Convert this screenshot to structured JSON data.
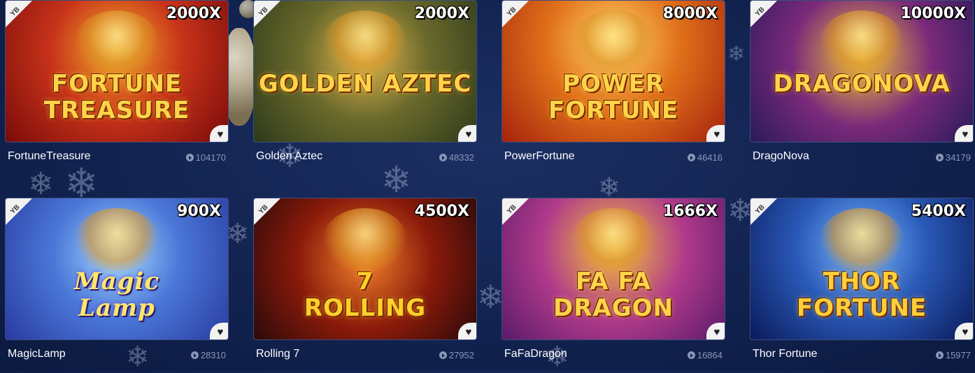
{
  "games": [
    {
      "name": "FortuneTreasure",
      "plays": "104170",
      "multiplier": "2000X",
      "provider": "YB",
      "art_title": "FORTUNE\nTREASURE"
    },
    {
      "name": "Golden Aztec",
      "plays": "48332",
      "multiplier": "2000X",
      "provider": "YB",
      "art_title": "GOLDEN AZTEC"
    },
    {
      "name": "PowerFortune",
      "plays": "46416",
      "multiplier": "8000X",
      "provider": "YB",
      "art_title": "POWER\nFORTUNE"
    },
    {
      "name": "DragoNova",
      "plays": "34179",
      "multiplier": "10000X",
      "provider": "YB",
      "art_title": "DRAGONOVA"
    },
    {
      "name": "MagicLamp",
      "plays": "28310",
      "multiplier": "900X",
      "provider": "YB",
      "art_title": "Magic\nLamp"
    },
    {
      "name": "Rolling 7",
      "plays": "27952",
      "multiplier": "4500X",
      "provider": "YB",
      "art_title": "7\nROLLING"
    },
    {
      "name": "FaFaDragon",
      "plays": "16864",
      "multiplier": "1666X",
      "provider": "YB",
      "art_title": "FA FA\nDRAGON"
    },
    {
      "name": "Thor Fortune",
      "plays": "15977",
      "multiplier": "5400X",
      "provider": "YB",
      "art_title": "THOR\nFORTUNE"
    }
  ],
  "icons": {
    "favorite": "heart-icon",
    "plays": "play-icon",
    "provider": "yb-badge"
  },
  "colors": {
    "background": "#122350",
    "multiplier_text": "#ffffff",
    "game_name": "#ffffff",
    "play_count": "#8a97b8"
  }
}
